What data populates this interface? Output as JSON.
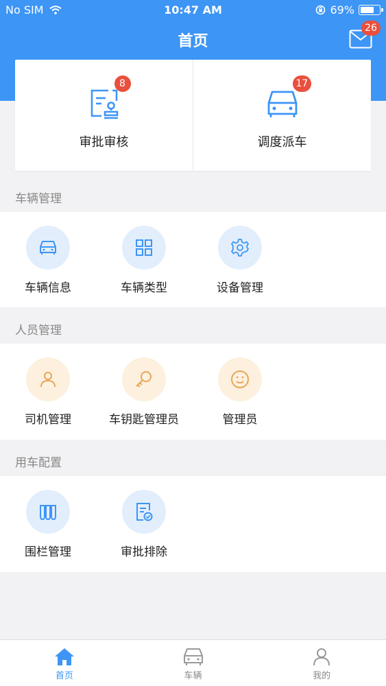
{
  "status_bar": {
    "carrier": "No SIM",
    "time": "10:47 AM",
    "battery": "69%"
  },
  "header": {
    "title": "首页",
    "mail_badge": "26"
  },
  "top_cards": [
    {
      "label": "审批审核",
      "badge": "8",
      "icon": "approval-stamp-icon"
    },
    {
      "label": "调度派车",
      "badge": "17",
      "icon": "car-icon"
    }
  ],
  "sections": [
    {
      "title": "车辆管理",
      "items": [
        {
          "label": "车辆信息",
          "icon": "car-icon"
        },
        {
          "label": "车辆类型",
          "icon": "grid-icon"
        },
        {
          "label": "设备管理",
          "icon": "gear-icon"
        }
      ]
    },
    {
      "title": "人员管理",
      "items": [
        {
          "label": "司机管理",
          "icon": "person-icon"
        },
        {
          "label": "车钥匙管理员",
          "icon": "key-icon"
        },
        {
          "label": "管理员",
          "icon": "smiley-icon"
        }
      ]
    },
    {
      "title": "用车配置",
      "items": [
        {
          "label": "围栏管理",
          "icon": "fence-icon"
        },
        {
          "label": "审批排除",
          "icon": "document-check-icon"
        }
      ]
    }
  ],
  "tabbar": [
    {
      "label": "首页",
      "icon": "home-icon",
      "active": true
    },
    {
      "label": "车辆",
      "icon": "car-icon",
      "active": false
    },
    {
      "label": "我的",
      "icon": "person-icon",
      "active": false
    }
  ],
  "colors": {
    "primary": "#3d95f5",
    "badge": "#e9503d",
    "icon_orange": "#e9a65a",
    "icon_blue": "#3d95f5"
  }
}
